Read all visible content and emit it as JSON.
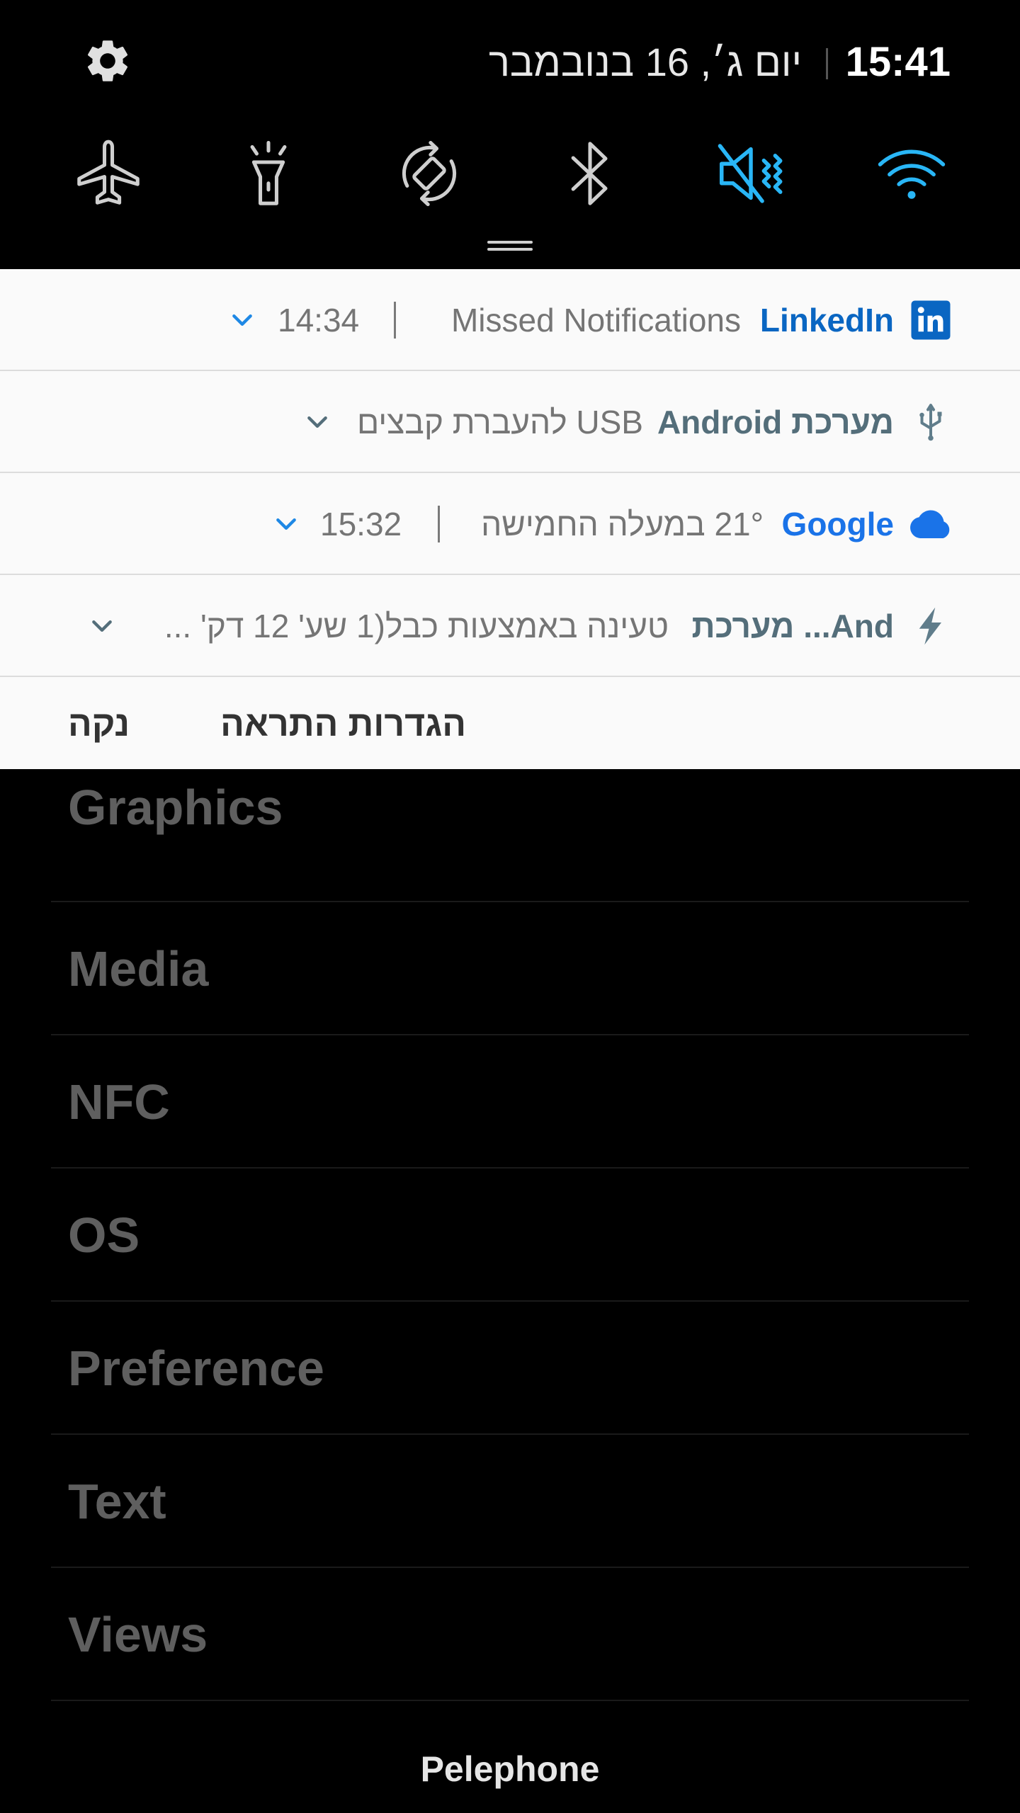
{
  "status": {
    "time": "15:41",
    "date": "יום ג׳, 16 בנובמבר"
  },
  "quick_settings": [
    {
      "name": "airplane",
      "icon": "airplane-icon",
      "active": false
    },
    {
      "name": "flashlight",
      "icon": "flashlight-icon",
      "active": false
    },
    {
      "name": "auto-rotate",
      "icon": "rotate-icon",
      "active": false
    },
    {
      "name": "bluetooth",
      "icon": "bluetooth-icon",
      "active": false
    },
    {
      "name": "sound",
      "icon": "mute-vibrate-icon",
      "active": true
    },
    {
      "name": "wifi",
      "icon": "wifi-icon",
      "active": true
    }
  ],
  "notifications": [
    {
      "app": "LinkedIn",
      "text": "Missed Notifications",
      "time": "14:34",
      "icon": "linkedin-icon",
      "app_color": "#0a66c2"
    },
    {
      "app": "מערכת Android",
      "text": "USB להעברת קבצים",
      "icon": "usb-icon",
      "app_color": "#546e7a"
    },
    {
      "app": "Google",
      "text": "21° במעלה החמישה",
      "time": "15:32",
      "icon": "cloud-icon",
      "app_color": "#1a73e8"
    },
    {
      "app": "מערכת ...And",
      "text": "טעינה באמצעות כבל(1 שע' 12 דק' ...",
      "icon": "bolt-icon",
      "app_color": "#546e7a"
    }
  ],
  "actions": {
    "settings": "הגדרות התראה",
    "clear": "נקה"
  },
  "list": [
    "Graphics",
    "Media",
    "NFC",
    "OS",
    "Preference",
    "Text",
    "Views"
  ],
  "carrier": "Pelephone",
  "colors": {
    "accent_active": "#29b6f6",
    "icon_inactive": "#cfcfcf"
  }
}
